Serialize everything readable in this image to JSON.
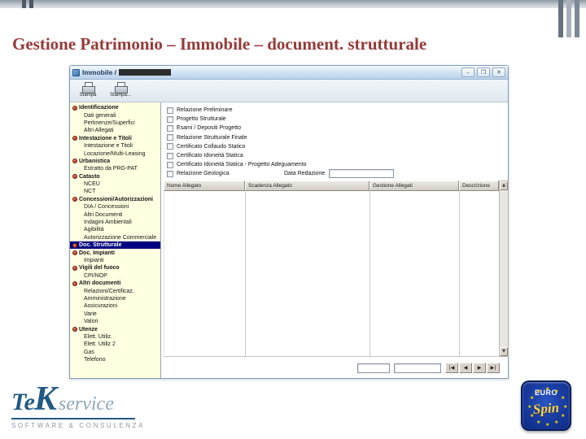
{
  "slide": {
    "title": "Gestione Patrimonio – Immobile – document. strutturale"
  },
  "window": {
    "title": "Immobile / ",
    "controls": {
      "minimize": "–",
      "maximize": "❐",
      "close": "✕"
    },
    "toolbar": [
      {
        "label": "Stampa"
      },
      {
        "label": "Stampa..."
      }
    ],
    "tree": [
      {
        "type": "group",
        "label": "Identificazione"
      },
      {
        "type": "item",
        "label": "Dati generali"
      },
      {
        "type": "item",
        "label": "Pertinenze/Superfici"
      },
      {
        "type": "item",
        "label": "Altri Allegati"
      },
      {
        "type": "group",
        "label": "Intestazione e Titoli"
      },
      {
        "type": "item",
        "label": "Intestazione e Titoli"
      },
      {
        "type": "item",
        "label": "Locazione/Multi-Leasing"
      },
      {
        "type": "group",
        "label": "Urbanistica"
      },
      {
        "type": "item",
        "label": "Estratto da PRG-PAT"
      },
      {
        "type": "group",
        "label": "Catasto"
      },
      {
        "type": "item",
        "label": "NCEU"
      },
      {
        "type": "item",
        "label": "NCT"
      },
      {
        "type": "group",
        "label": "Concessioni/Autorizzazioni"
      },
      {
        "type": "item",
        "label": "DIA / Concessioni"
      },
      {
        "type": "item",
        "label": "Altri Documenti"
      },
      {
        "type": "item",
        "label": "Indagini Ambientali"
      },
      {
        "type": "item",
        "label": "Agibilità"
      },
      {
        "type": "item",
        "label": "Autorizzazione Commerciale"
      },
      {
        "type": "group",
        "label": "Doc. Strutturale",
        "selected": true
      },
      {
        "type": "group",
        "label": "Doc. Impianti"
      },
      {
        "type": "item",
        "label": "Impianti"
      },
      {
        "type": "group",
        "label": "Vigili del fuoco"
      },
      {
        "type": "item",
        "label": "CPI/NOP"
      },
      {
        "type": "group",
        "label": "Altri documenti"
      },
      {
        "type": "item",
        "label": "Relazioni/Certificaz."
      },
      {
        "type": "item",
        "label": "Amministrazione"
      },
      {
        "type": "item",
        "label": "Assicurazioni"
      },
      {
        "type": "item",
        "label": "Varie"
      },
      {
        "type": "item",
        "label": "Valori"
      },
      {
        "type": "group",
        "label": "Utenze"
      },
      {
        "type": "item",
        "label": "Elett. Utiliz."
      },
      {
        "type": "item",
        "label": "Elett. Utiliz 2"
      },
      {
        "type": "item",
        "label": "Gas"
      },
      {
        "type": "item",
        "label": "Telefono"
      }
    ],
    "checklist": [
      "Relazione Preliminare",
      "Progetto Strutturale",
      "Esami / Depositi Progetto",
      "Relazione Strutturale Finale",
      "Certificato Collaudo Statico",
      "Certificato Idoneità Statica",
      "Certificato Idoneità Statica - Progetto Adeguamento",
      "Relazione Geologica"
    ],
    "date_label": "Data Redazione",
    "date_value": "",
    "table": {
      "columns": [
        "Nome Allegato",
        "Scadenza Allegato",
        "Gestione Allegati",
        "Descrizione"
      ]
    },
    "scrollbar": {
      "up": "▲",
      "down": "▼"
    },
    "footer": {
      "field1": "",
      "field2": "",
      "nav": [
        "|◀",
        "◀",
        "▶",
        "▶|"
      ]
    }
  },
  "logos": {
    "tek": {
      "te": "Te",
      "k": "K",
      "service": "service",
      "caption": "SOFTWARE & CONSULENZA"
    },
    "eurospin": {
      "euro": "EURO",
      "spin": "Spin",
      "star": "★"
    }
  },
  "colors": {
    "slide_title": "#963a38",
    "tree_selection": "#000080",
    "tree_background": "#ffffe1",
    "tek_blue": "#215a84",
    "eurospin_blue": "#173a9e",
    "eurospin_yellow": "#ffd23e"
  }
}
